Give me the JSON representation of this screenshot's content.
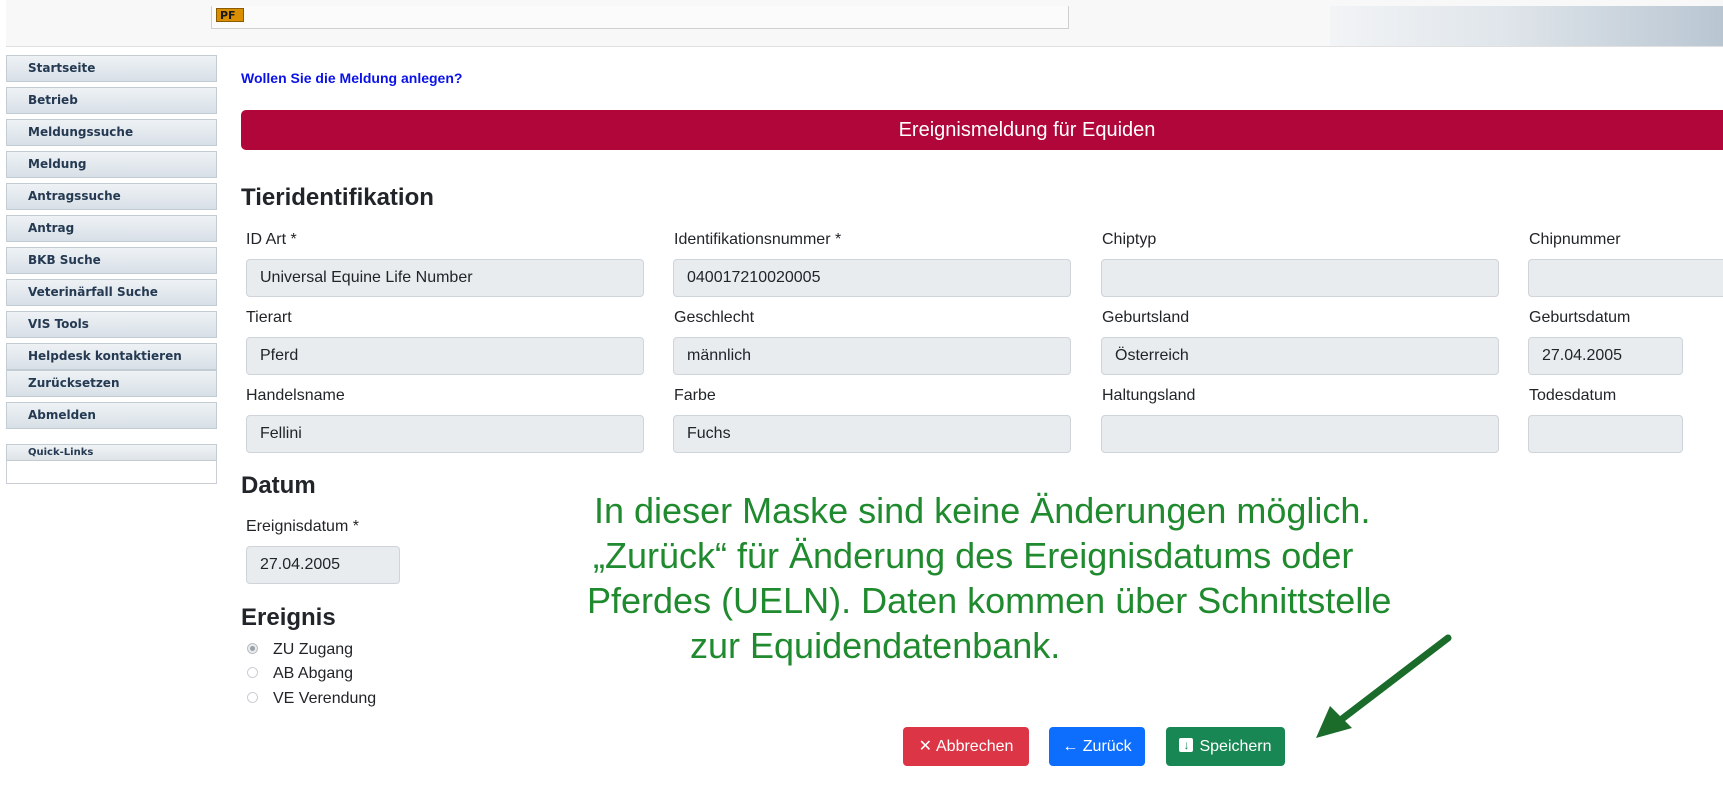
{
  "header": {
    "logo_text": "PF"
  },
  "sidebar": {
    "items": [
      {
        "label": "Startseite"
      },
      {
        "label": "Betrieb"
      },
      {
        "label": "Meldungssuche"
      },
      {
        "label": "Meldung"
      },
      {
        "label": "Antragssuche"
      },
      {
        "label": "Antrag"
      },
      {
        "label": "BKB Suche"
      },
      {
        "label": "Veterinärfall Suche"
      },
      {
        "label": "VIS Tools"
      },
      {
        "label": "Helpdesk kontaktieren"
      },
      {
        "label": "Zurücksetzen"
      },
      {
        "label": "Abmelden"
      }
    ],
    "quick_links_label": "Quick-Links"
  },
  "main": {
    "question": "Wollen Sie die Meldung anlegen?",
    "banner": "Ereignismeldung für Equiden",
    "tier_section": "Tieridentifikation",
    "fields": {
      "id_art": {
        "label": "ID Art *",
        "value": "Universal Equine Life Number"
      },
      "ident_nr": {
        "label": "Identifikationsnummer *",
        "value": "040017210020005"
      },
      "chiptyp": {
        "label": "Chiptyp",
        "value": ""
      },
      "chipnummer": {
        "label": "Chipnummer",
        "value": ""
      },
      "tierart": {
        "label": "Tierart",
        "value": "Pferd"
      },
      "geschlecht": {
        "label": "Geschlecht",
        "value": "männlich"
      },
      "geburtsland": {
        "label": "Geburtsland",
        "value": "Österreich"
      },
      "geburtsdatum": {
        "label": "Geburtsdatum",
        "value": "27.04.2005"
      },
      "handelsname": {
        "label": "Handelsname",
        "value": "Fellini"
      },
      "farbe": {
        "label": "Farbe",
        "value": "Fuchs"
      },
      "haltungsland": {
        "label": "Haltungsland",
        "value": ""
      },
      "todesdatum": {
        "label": "Todesdatum",
        "value": ""
      }
    },
    "datum_section": "Datum",
    "ereignisdatum": {
      "label": "Ereignisdatum *",
      "value": "27.04.2005"
    },
    "ereignis_section": "Ereignis",
    "ereignis_options": [
      {
        "label": "ZU Zugang",
        "checked": true
      },
      {
        "label": "AB Abgang",
        "checked": false
      },
      {
        "label": "VE Verendung",
        "checked": false
      }
    ]
  },
  "annotation": {
    "lines": [
      "In dieser Maske sind keine Änderungen möglich.",
      "„Zurück“ für Änderung des Ereignisdatums oder",
      "Pferdes (UELN). Daten kommen über Schnittstelle",
      "zur Equidendatenbank."
    ],
    "color": "#1f8a2e",
    "arrow_color": "#1b6b2a"
  },
  "buttons": {
    "cancel": "Abbrechen",
    "back": "← Zurück",
    "save": "Speichern"
  },
  "colors": {
    "banner": "#b0063a",
    "question": "#0a12e8",
    "cancel": "#dc3545",
    "back": "#0d6efd",
    "save": "#198754"
  }
}
